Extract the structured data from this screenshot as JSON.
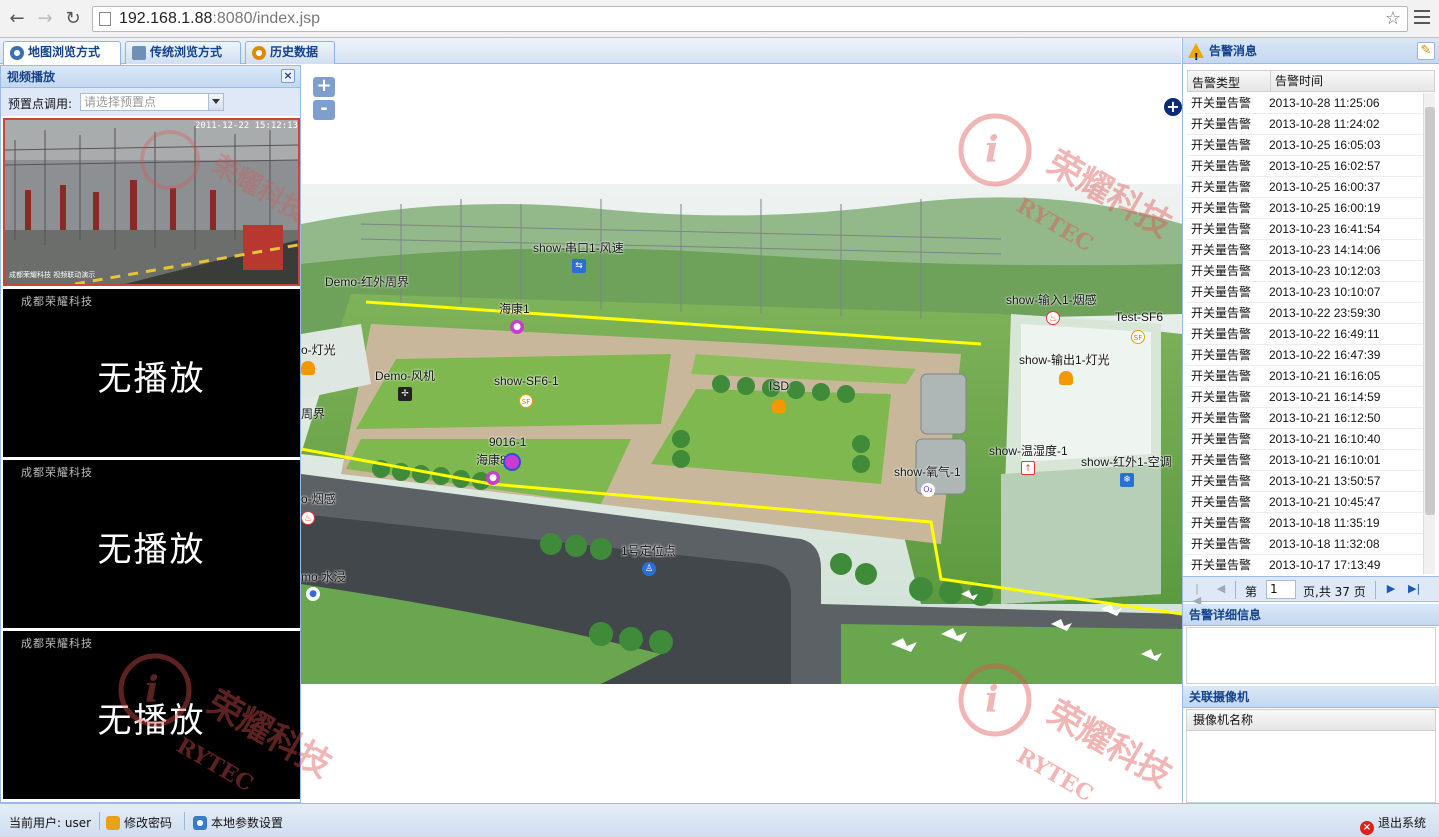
{
  "browser": {
    "url_host": "192.168.1.88",
    "url_rest": ":8080/index.jsp"
  },
  "tabs": [
    {
      "label": "地图浏览方式",
      "active": true
    },
    {
      "label": "传统浏览方式",
      "active": false
    },
    {
      "label": "历史数据",
      "active": false
    }
  ],
  "video_panel": {
    "title": "视频播放",
    "preset_label": "预置点调用:",
    "preset_placeholder": "请选择预置点",
    "video1_overlay_time": "2011-12-22  15:12:13",
    "video1_overlay_caption": "成都荣耀科技 视频联动演示",
    "brand": "成都荣耀科技",
    "no_play": "无播放"
  },
  "map": {
    "zoom_in": "+",
    "zoom_out": "-",
    "layer_switch": "+",
    "labels": {
      "show_serial": "show-串口1-风速",
      "demo_fence": "Demo-红外周界",
      "haikang1": "海康1",
      "show_input_smoke": "show-输入1-烟感",
      "test_sf6": "Test-SF6",
      "demo_light": "o-灯光",
      "demo_fan": "Demo-风机",
      "show_sf6": "show-SF6-1",
      "isd": "ISD",
      "show_output_light": "show-输出1-灯光",
      "fence_cut": "周界",
      "id_9016": "9016-1",
      "haikang8": "海康8",
      "show_temp": "show-温湿度-1",
      "show_ac": "show-红外1-空调",
      "show_oxygen": "show-氧气-1",
      "demo_smoke": "o-烟感",
      "locate1": "1号定位点",
      "demo_water": "mo-水浸"
    }
  },
  "alarm_panel": {
    "title": "告警消息",
    "col_type": "告警类型",
    "col_time": "告警时间",
    "rows": [
      {
        "type": "开关量告警",
        "time": "2013-10-28 11:25:06"
      },
      {
        "type": "开关量告警",
        "time": "2013-10-28 11:24:02"
      },
      {
        "type": "开关量告警",
        "time": "2013-10-25 16:05:03"
      },
      {
        "type": "开关量告警",
        "time": "2013-10-25 16:02:57"
      },
      {
        "type": "开关量告警",
        "time": "2013-10-25 16:00:37"
      },
      {
        "type": "开关量告警",
        "time": "2013-10-25 16:00:19"
      },
      {
        "type": "开关量告警",
        "time": "2013-10-23 16:41:54"
      },
      {
        "type": "开关量告警",
        "time": "2013-10-23 14:14:06"
      },
      {
        "type": "开关量告警",
        "time": "2013-10-23 10:12:03"
      },
      {
        "type": "开关量告警",
        "time": "2013-10-23 10:10:07"
      },
      {
        "type": "开关量告警",
        "time": "2013-10-22 23:59:30"
      },
      {
        "type": "开关量告警",
        "time": "2013-10-22 16:49:11"
      },
      {
        "type": "开关量告警",
        "time": "2013-10-22 16:47:39"
      },
      {
        "type": "开关量告警",
        "time": "2013-10-21 16:16:05"
      },
      {
        "type": "开关量告警",
        "time": "2013-10-21 16:14:59"
      },
      {
        "type": "开关量告警",
        "time": "2013-10-21 16:12:50"
      },
      {
        "type": "开关量告警",
        "time": "2013-10-21 16:10:40"
      },
      {
        "type": "开关量告警",
        "time": "2013-10-21 16:10:01"
      },
      {
        "type": "开关量告警",
        "time": "2013-10-21 13:50:57"
      },
      {
        "type": "开关量告警",
        "time": "2013-10-21 10:45:47"
      },
      {
        "type": "开关量告警",
        "time": "2013-10-18 11:35:19"
      },
      {
        "type": "开关量告警",
        "time": "2013-10-18 11:32:08"
      },
      {
        "type": "开关量告警",
        "time": "2013-10-17 17:13:49"
      }
    ],
    "pager": {
      "page_label": "第",
      "page_value": "1",
      "total_label": "页,共 37 页"
    },
    "detail_title": "告警详细信息",
    "camera_title": "关联摄像机",
    "camera_col": "摄像机名称"
  },
  "statusbar": {
    "user_label": "当前用户: user",
    "change_password": "修改密码",
    "local_settings": "本地参数设置",
    "logout": "退出系统"
  },
  "watermark": {
    "cn": "荣耀科技",
    "en": "RYTEC"
  },
  "colors": {
    "panel_border": "#99bbe8",
    "header_text": "#15428b",
    "fence_line": "#ffff00"
  }
}
